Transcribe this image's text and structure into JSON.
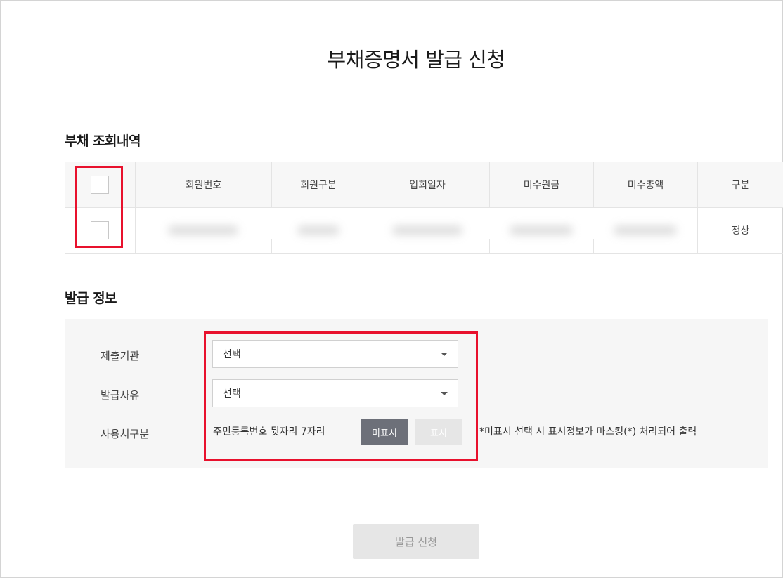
{
  "page_title": "부채증명서 발급 신청",
  "debt_section": {
    "title": "부채 조회내역",
    "columns": [
      "회원번호",
      "회원구분",
      "입회일자",
      "미수원금",
      "미수총액",
      "구분"
    ],
    "rows": [
      {
        "member_no": "",
        "member_type": "",
        "join_date": "",
        "principal": "",
        "total": "",
        "status": "정상"
      }
    ]
  },
  "issue_section": {
    "title": "발급 정보",
    "fields": {
      "institution": {
        "label": "제출기관",
        "value": "선택"
      },
      "reason": {
        "label": "발급사유",
        "value": "선택"
      },
      "usage": {
        "label": "사용처구분",
        "text": "주민등록번호 뒷자리 7자리"
      }
    },
    "mask_button": "미표시",
    "show_button": "표시",
    "note": "*미표시 선택 시 표시정보가 마스킹(*) 처리되어 출력"
  },
  "submit_label": "발급 신청"
}
